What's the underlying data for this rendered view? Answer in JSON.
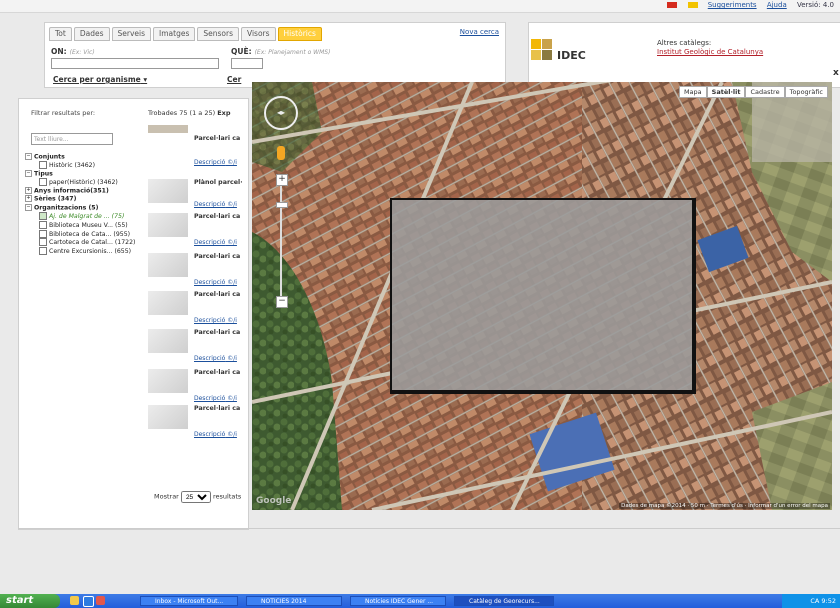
{
  "top": {
    "right_items": [
      "Suggeriments",
      "Ajuda",
      "Versió: 4.0"
    ]
  },
  "search": {
    "tabs": [
      "Tot",
      "Dades",
      "Serveis",
      "Imatges",
      "Sensors",
      "Visors",
      "Històrics"
    ],
    "active_tab": "Històrics",
    "nova_cerca": "Nova cerca",
    "on_label": "ON:",
    "on_hint": "(Ex: Vic)",
    "que_label": "QUÈ:",
    "que_hint": "(Ex: Planejament o WMS)",
    "cerca_organisme": "Cerca per organisme",
    "cerca_cut": "Cer"
  },
  "idec": {
    "logo_text": "IDEC",
    "altres_title": "Altres catàlegs:",
    "altres_link": "Institut Geològic de Catalunya"
  },
  "filter": {
    "title": "Filtrar resultats per:",
    "input_placeholder": "Text lliure...",
    "conjunts": "Conjunts",
    "historic": "Històric (3462)",
    "tipus": "Tipus",
    "paper": "paper(Històric) (3462)",
    "anys": "Anys informació(351)",
    "series": "Sèries (347)",
    "organitzacions": "Organitzacions (5)",
    "orgs": [
      "Aj. de Malgrat de ... (75)",
      "Biblioteca Museu V... (55)",
      "Biblioteca de Cata... (955)",
      "Cartoteca de Catal... (1722)",
      "Centre Excursionis... (655)"
    ]
  },
  "results": {
    "head": "Trobades 75 (1 a 25)",
    "head_suffix": "Exp",
    "rows": [
      {
        "title": "Parcel·lari ca",
        "desc": "Descripció"
      },
      {
        "title": "Plànol parcel·",
        "desc": "Descripció"
      },
      {
        "title": "Parcel·lari ca",
        "desc": "Descripció"
      },
      {
        "title": "Parcel·lari ca",
        "desc": "Descripció"
      },
      {
        "title": "Parcel·lari ca",
        "desc": "Descripció"
      },
      {
        "title": "Parcel·lari ca",
        "desc": "Descripció"
      },
      {
        "title": "Parcel·lari ca",
        "desc": "Descripció"
      },
      {
        "title": "Parcel·lari ca",
        "desc": "Descripció"
      }
    ],
    "mostrar": "Mostrar",
    "mostrar_value": "25",
    "mostrar_suffix": "resultats"
  },
  "map": {
    "types": [
      "Mapa",
      "Satèl·lit",
      "Cadastre",
      "Topogràfic"
    ],
    "selected": "Satèl·lit",
    "credits": "Dades de mapa ©2014 · 50 m · Termes d'ús · Informar d'un error del mapa",
    "google": "Google",
    "close": "x"
  },
  "taskbar": {
    "start": "start",
    "items": [
      "Inbox - Microsoft Out...",
      "NOTICIES 2014",
      "Notícies IDEC Gener ...",
      "Catàleg de Georecurs..."
    ],
    "tray": "CA  9:52"
  }
}
